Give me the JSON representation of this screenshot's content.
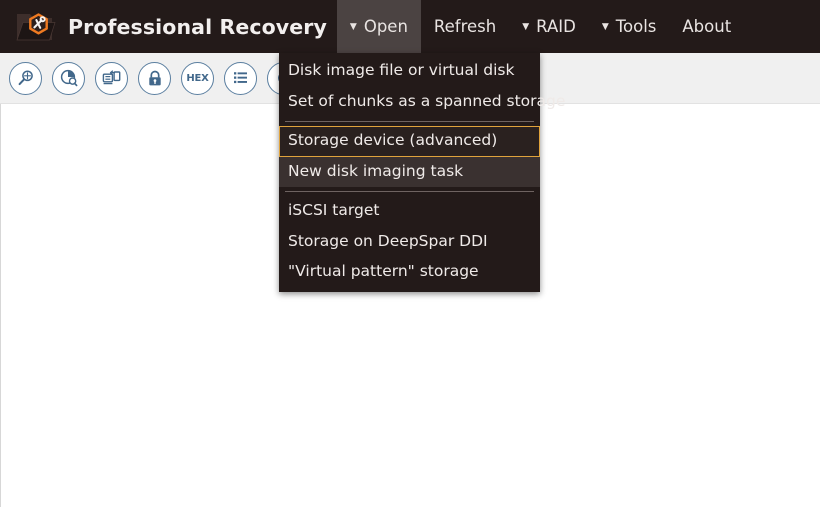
{
  "window": {
    "background_color": "#ffffff"
  },
  "header": {
    "background_color": "#231a19",
    "logo_icon": "folder-tools-logo-icon",
    "title": "Professional Recovery",
    "menus": [
      {
        "id": "open",
        "label": "Open",
        "has_caret": true,
        "active": true
      },
      {
        "id": "refresh",
        "label": "Refresh",
        "has_caret": false,
        "active": false
      },
      {
        "id": "raid",
        "label": "RAID",
        "has_caret": true,
        "active": false
      },
      {
        "id": "tools",
        "label": "Tools",
        "has_caret": true,
        "active": false
      },
      {
        "id": "about",
        "label": "About",
        "has_caret": false,
        "active": false
      }
    ],
    "caret_glyph": "▼",
    "active_background_color": "#4b4342"
  },
  "toolbar": {
    "background_color": "#f0f0f0",
    "icon_color": "#42688b",
    "buttons": [
      {
        "id": "search",
        "icon": "magnifier-icon",
        "label": ""
      },
      {
        "id": "disk-analysis",
        "icon": "pie-chart-magnifier-icon",
        "label": ""
      },
      {
        "id": "clone-disk",
        "icon": "disk-copy-icon",
        "label": ""
      },
      {
        "id": "lock",
        "icon": "padlock-icon",
        "label": ""
      },
      {
        "id": "hex-viewer",
        "icon": "hex-icon",
        "label": "HEX"
      },
      {
        "id": "list-view",
        "icon": "list-icon",
        "label": ""
      },
      {
        "id": "more",
        "icon": "circle-icon",
        "label": ""
      }
    ]
  },
  "dropdown": {
    "owner_menu": "Open",
    "background_color": "#231a19",
    "selected_border_color": "#e0a33c",
    "hover_background_color": "#3a3130",
    "items": [
      {
        "id": "disk-image-file",
        "label": "Disk image file or virtual disk",
        "state": "normal",
        "separator_before": false
      },
      {
        "id": "spanned-chunks",
        "label": "Set of chunks as a spanned storage",
        "state": "normal",
        "separator_before": false
      },
      {
        "id": "storage-device-adv",
        "label": "Storage device (advanced)",
        "state": "selected",
        "separator_before": true
      },
      {
        "id": "new-imaging-task",
        "label": "New disk imaging task",
        "state": "hover",
        "separator_before": false
      },
      {
        "id": "iscsi-target",
        "label": "iSCSI target",
        "state": "normal",
        "separator_before": true
      },
      {
        "id": "deepspar-ddi",
        "label": "Storage on DeepSpar DDI",
        "state": "normal",
        "separator_before": false
      },
      {
        "id": "virtual-pattern",
        "label": "\"Virtual pattern\" storage",
        "state": "normal",
        "separator_before": false
      }
    ]
  }
}
